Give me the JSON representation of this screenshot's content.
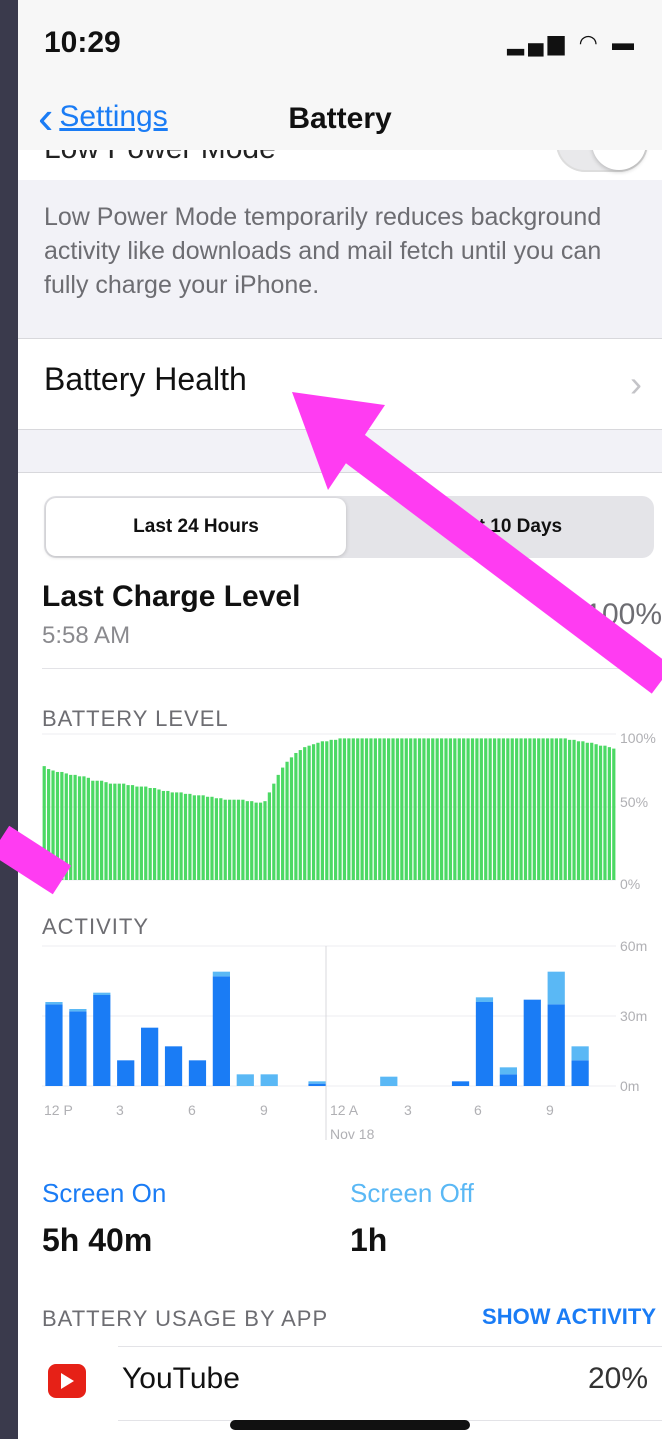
{
  "status_bar": {
    "time": "10:29",
    "icons": "signal wifi battery"
  },
  "nav": {
    "back_label": "Settings",
    "title": "Battery"
  },
  "low_power": {
    "label": "Low Power Mode",
    "enabled": false,
    "footer": "Low Power Mode temporarily reduces background activity like downloads and mail fetch until you can fully charge your iPhone."
  },
  "battery_health": {
    "label": "Battery Health"
  },
  "segments": {
    "option_a": "Last 24 Hours",
    "option_b": "Last 10 Days",
    "selected": "Last 24 Hours"
  },
  "last_charge": {
    "label": "Last Charge Level",
    "time": "5:58 AM",
    "value": "100%"
  },
  "battery_level": {
    "title": "BATTERY LEVEL",
    "y_ticks": [
      "100%",
      "50%",
      "0%"
    ]
  },
  "activity": {
    "title": "ACTIVITY",
    "y_ticks": [
      "60m",
      "30m",
      "0m"
    ],
    "x_ticks": [
      "12 P",
      "3",
      "6",
      "9",
      "12 A",
      "3",
      "6",
      "9"
    ],
    "date_label": "Nov 18"
  },
  "chart_data": [
    {
      "type": "bar",
      "title": "BATTERY LEVEL",
      "unit": "%",
      "ylim": [
        0,
        100
      ],
      "values": [
        78,
        76,
        75,
        74,
        74,
        73,
        72,
        72,
        71,
        71,
        70,
        68,
        68,
        68,
        67,
        66,
        66,
        66,
        66,
        65,
        65,
        64,
        64,
        64,
        63,
        63,
        62,
        61,
        61,
        60,
        60,
        60,
        59,
        59,
        58,
        58,
        58,
        57,
        57,
        56,
        56,
        55,
        55,
        55,
        55,
        55,
        54,
        54,
        53,
        53,
        54,
        60,
        66,
        72,
        77,
        81,
        84,
        87,
        89,
        91,
        92,
        93,
        94,
        95,
        95,
        96,
        96,
        97,
        97,
        97,
        97,
        97,
        97,
        97,
        97,
        97,
        97,
        97,
        97,
        97,
        97,
        97,
        97,
        97,
        97,
        97,
        97,
        97,
        97,
        97,
        97,
        97,
        97,
        97,
        97,
        97,
        97,
        97,
        97,
        97,
        97,
        97,
        97,
        97,
        97,
        97,
        97,
        97,
        97,
        97,
        97,
        97,
        97,
        97,
        97,
        97,
        97,
        97,
        97,
        96,
        96,
        95,
        95,
        94,
        94,
        93,
        92,
        92,
        91,
        90
      ]
    },
    {
      "type": "bar",
      "title": "ACTIVITY",
      "unit": "min",
      "ylim": [
        0,
        60
      ],
      "categories": [
        "12 P",
        "1",
        "2",
        "3",
        "4",
        "5",
        "6",
        "7",
        "8",
        "9",
        "10",
        "11",
        "12 A",
        "1",
        "2",
        "3",
        "4",
        "5",
        "6",
        "7",
        "8",
        "9",
        "10",
        "11"
      ],
      "series": [
        {
          "name": "Screen On",
          "color": "#1a7cf5",
          "values": [
            35,
            32,
            39,
            11,
            25,
            17,
            11,
            47,
            0,
            0,
            0,
            1,
            0,
            0,
            0,
            0,
            0,
            2,
            36,
            5,
            37,
            35,
            11,
            0
          ]
        },
        {
          "name": "Screen Off",
          "color": "#5ab8f5",
          "values": [
            1,
            1,
            1,
            0,
            0,
            0,
            0,
            2,
            5,
            5,
            0,
            1,
            0,
            0,
            4,
            0,
            0,
            0,
            2,
            3,
            0,
            14,
            6,
            0
          ]
        }
      ]
    }
  ],
  "screen_on": {
    "label": "Screen On",
    "value": "5h 40m"
  },
  "screen_off": {
    "label": "Screen Off",
    "value": "1h"
  },
  "usage": {
    "header": "BATTERY USAGE BY APP",
    "action": "SHOW ACTIVITY",
    "apps": [
      {
        "name": "YouTube",
        "percent": "20%",
        "icon": "youtube-icon"
      }
    ]
  },
  "colors": {
    "accent": "#1a7cf5",
    "battery_green": "#4cd964",
    "screen_off": "#5ab8f5",
    "annotation_arrow": "#ff3cf2"
  }
}
